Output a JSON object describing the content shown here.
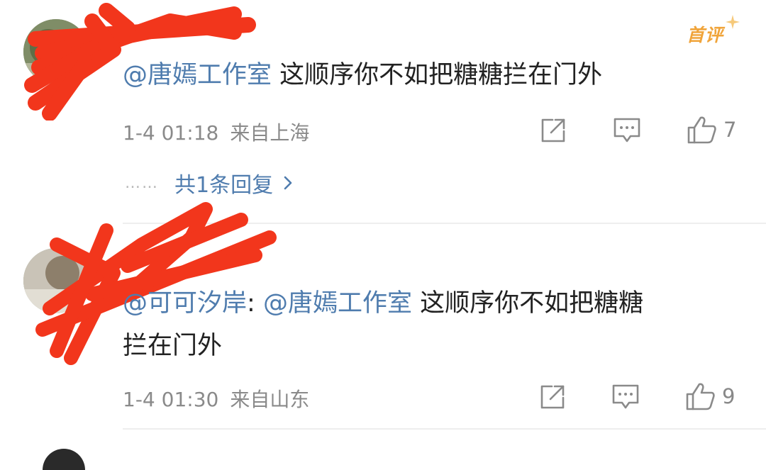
{
  "badge": {
    "label": "首评"
  },
  "comments": [
    {
      "mention": "@唐嫣工作室",
      "text": " 这顺序你不如把糖糖拦在门外",
      "date": "1-4 01:18",
      "location": "来自上海",
      "like_count": "7",
      "replies_label": "共1条回复",
      "replies_dots": "……"
    },
    {
      "mention1": "@可可汐岸",
      "colon": ": ",
      "mention2": "@唐嫣工作室",
      "text_line1": " 这顺序你不如把糖糖",
      "text_line2": "拦在门外",
      "date": "1-4 01:30",
      "location": "来自山东",
      "like_count": "9"
    }
  ],
  "icons": [
    "share-icon",
    "comment-icon",
    "like-icon",
    "chevron-right-icon"
  ],
  "colors": {
    "mention": "#4f7cae",
    "meta": "#8a8a8a",
    "badge": "#f0a43a",
    "redaction": "#f2361c"
  }
}
